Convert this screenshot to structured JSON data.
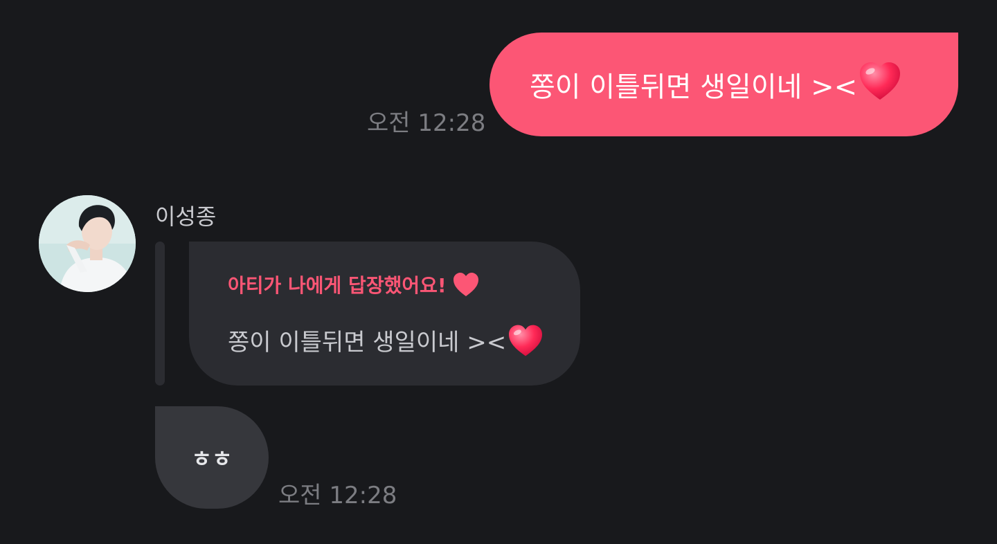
{
  "sent_message": {
    "text": "쫑이 이틀뒤면 생일이네 ><",
    "emoji": "heart-emoji",
    "time": "오전 12:28"
  },
  "received": {
    "sender_name": "이성종",
    "avatar": "profile-photo",
    "reply_label": "아티가 나에게 답장했어요!",
    "reply_quote": "쫑이 이틀뒤면 생일이네 ><",
    "message": "ㅎㅎ",
    "time": "오전 12:28"
  },
  "colors": {
    "background": "#18191c",
    "sent_bubble": "#fc5675",
    "accent": "#fc5675",
    "received_bubble": "#36373c",
    "reply_card": "#2b2c31",
    "timestamp": "#7c7d82"
  }
}
